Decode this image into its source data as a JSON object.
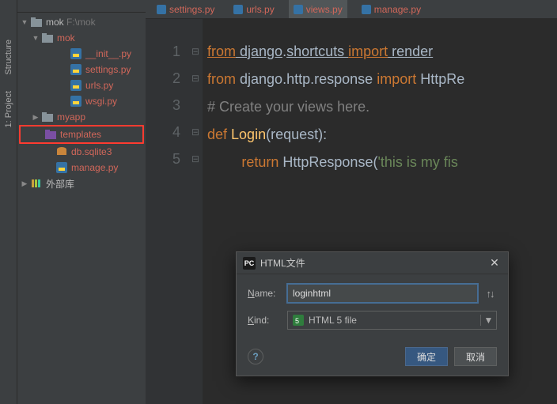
{
  "tool_stripe": {
    "projects": "1: Project",
    "structure": "Structure"
  },
  "tree": {
    "root": {
      "name": "mok",
      "path": "F:\\mok"
    },
    "mok_pkg": "mok",
    "files": {
      "init": "__init__.py",
      "settings": "settings.py",
      "urls": "urls.py",
      "wsgi": "wsgi.py"
    },
    "myapp": "myapp",
    "templates": "templates",
    "dbsqlite": "db.sqlite3",
    "manage": "manage.py",
    "ext_lib": "外部库"
  },
  "tabs": {
    "t1": "settings.py",
    "t2": "urls.py",
    "t3": "views.py",
    "t4": "manage.py"
  },
  "code": {
    "l1a": "from",
    "l1b": " django",
    "l1c": ".",
    "l1d": "shortcuts ",
    "l1e": "import",
    "l1f": " render",
    "l2a": "from ",
    "l2b": "django",
    "l2c": ".",
    "l2d": "http",
    "l2e": ".",
    "l2f": "response ",
    "l2g": "import ",
    "l2h": "HttpRe",
    "l3": "# Create your views here.",
    "l4a": "def ",
    "l4b": "Login",
    "l4c": "(request):",
    "l5a": "return ",
    "l5b": "HttpResponse(",
    "l5c": "'this is my fis"
  },
  "gutter": [
    "1",
    "2",
    "3",
    "4",
    "5"
  ],
  "dialog": {
    "title": "HTML文件",
    "name_label": "Name:",
    "name_value": "loginhtml",
    "kind_label": "Kind:",
    "kind_value": "HTML 5 file",
    "ok": "确定",
    "cancel": "取消"
  }
}
